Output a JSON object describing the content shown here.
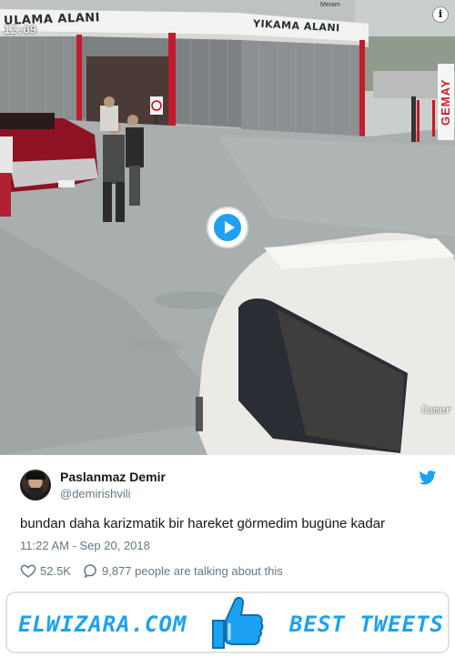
{
  "video": {
    "timestamp": "12:09",
    "overlay_label": "Camer",
    "sign_left": "ULAMA ALANI",
    "sign_right": "YIKAMA ALANI",
    "street_sign": "Meram",
    "vertical_sign": "GEMAY",
    "info_icon": "info-icon",
    "play_icon": "play-icon"
  },
  "tweet": {
    "author_name": "Paslanmaz Demir",
    "author_handle": "@demirishvili",
    "text": "bundan daha karizmatik bir hareket görmedim bugüne kadar",
    "timestamp": "11:22 AM - Sep 20, 2018",
    "likes": "52.5K",
    "talking": "9,877 people are talking about this",
    "accent_color": "#1da1f2",
    "muted_color": "#657786"
  },
  "banner": {
    "left_text": "ELWIZARA.COM",
    "right_text": "BEST TWEETS",
    "icon": "thumbs-up-icon"
  }
}
